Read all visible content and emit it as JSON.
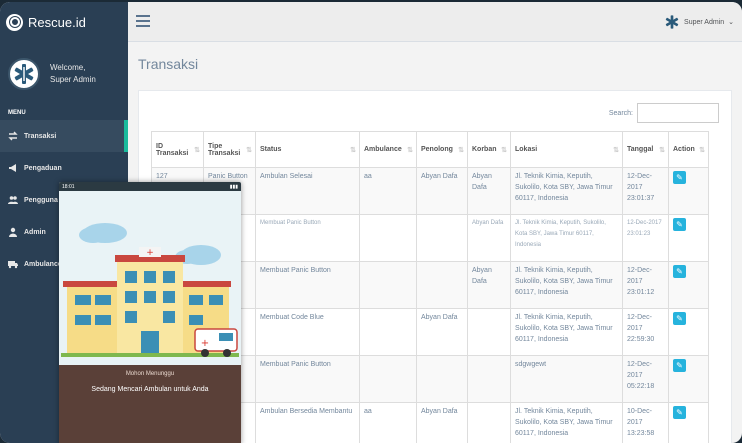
{
  "brand": {
    "name": "Rescue.id"
  },
  "profile": {
    "welcome": "Welcome,",
    "name": "Super Admin"
  },
  "sidebar": {
    "menu_title": "MENU",
    "items": [
      {
        "label": "Transaksi",
        "icon": "exchange-icon",
        "active": true
      },
      {
        "label": "Pengaduan",
        "icon": "bullhorn-icon"
      },
      {
        "label": "Pengguna",
        "icon": "users-icon"
      },
      {
        "label": "Admin",
        "icon": "user-icon"
      },
      {
        "label": "Ambulance",
        "icon": "ambulance-icon"
      }
    ]
  },
  "topbar": {
    "user": "Super Admin",
    "caret": "⌄"
  },
  "page": {
    "title": "Transaksi"
  },
  "search": {
    "label": "Search:"
  },
  "table": {
    "headers": [
      "ID Transaksi",
      "Tipe Transaksi",
      "Status",
      "Ambulance",
      "Penolong",
      "Korban",
      "Lokasi",
      "Tanggal",
      "Action"
    ],
    "rows": [
      [
        "127",
        "Panic Button",
        "Ambulan Selesai",
        "aa",
        "Abyan Dafa",
        "Abyan Dafa",
        "Jl. Teknik Kimia, Keputih, Sukolilo, Kota SBY, Jawa Timur 60117, Indonesia",
        "12-Dec-2017 23:01:37"
      ],
      [
        "",
        "",
        "Membuat Panic Button",
        "",
        "",
        "Abyan Dafa",
        "Jl. Teknik Kimia, Keputih, Sukolilo, Kota SBY, Jawa Timur 60117, Indonesia",
        "12-Dec-2017 23:01:23"
      ],
      [
        "",
        "",
        "Membuat Panic Button",
        "",
        "",
        "Abyan Dafa",
        "Jl. Teknik Kimia, Keputih, Sukolilo, Kota SBY, Jawa Timur 60117, Indonesia",
        "12-Dec-2017 23:01:12"
      ],
      [
        "",
        "",
        "Membuat Code Blue",
        "",
        "Abyan Dafa",
        "",
        "Jl. Teknik Kimia, Keputih, Sukolilo, Kota SBY, Jawa Timur 60117, Indonesia",
        "12-Dec-2017 22:59:30"
      ],
      [
        "",
        "",
        "Membuat Panic Button",
        "",
        "",
        "",
        "sdgwgewt",
        "12-Dec-2017 05:22:18"
      ],
      [
        "",
        "",
        "Ambulan Bersedia Membantu",
        "aa",
        "Abyan Dafa",
        "",
        "Jl. Teknik Kimia, Keputih, Sukolilo, Kota SBY, Jawa Timur 60117, Indonesia",
        "10-Dec-2017 13:23:58"
      ]
    ]
  },
  "phone": {
    "time": "18:01",
    "waiting": "Mohon Menunggu",
    "searching": "Sedang Mencari Ambulan untuk Anda"
  },
  "colors": {
    "sidebar": "#2a3f54",
    "accent": "#1abb9c",
    "action": "#26b3dd"
  }
}
